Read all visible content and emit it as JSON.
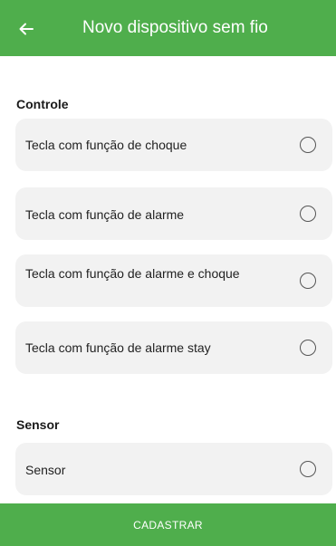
{
  "header": {
    "back_icon": "arrow-left-icon",
    "title": "Novo dispositivo sem fio"
  },
  "sections": {
    "controle": {
      "title": "Controle",
      "options": [
        {
          "label": "Tecla com função de choque",
          "selected": false
        },
        {
          "label": "Tecla com função de alarme",
          "selected": false
        },
        {
          "label": "Tecla com função de alarme e choque",
          "selected": false
        },
        {
          "label": "Tecla com função de alarme stay",
          "selected": false
        }
      ]
    },
    "sensor": {
      "title": "Sensor",
      "options": [
        {
          "label": "Sensor",
          "selected": false
        }
      ]
    }
  },
  "footer": {
    "submit_label": "CADASTRAR"
  },
  "colors": {
    "primary": "#4fae4c",
    "card_background": "#f2f2f2",
    "text": "#1a1a1a"
  }
}
